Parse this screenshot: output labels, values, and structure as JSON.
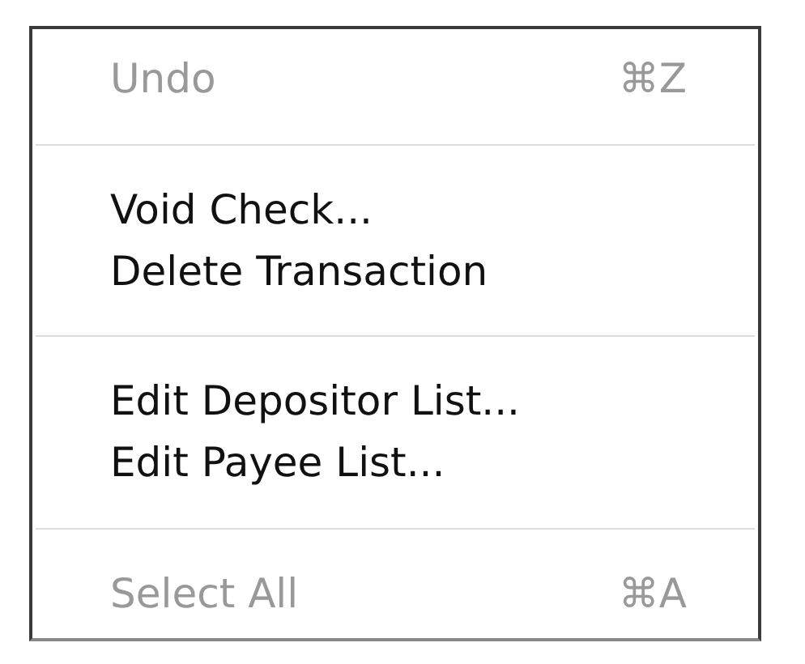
{
  "menu": {
    "sections": [
      {
        "items": [
          {
            "label": "Undo",
            "shortcut": "⌘Z",
            "disabled": true
          }
        ]
      },
      {
        "items": [
          {
            "label": "Void Check...",
            "disabled": false
          },
          {
            "label": "Delete Transaction",
            "disabled": false
          }
        ]
      },
      {
        "items": [
          {
            "label": "Edit Depositor List...",
            "disabled": false
          },
          {
            "label": "Edit Payee List...",
            "disabled": false
          }
        ]
      },
      {
        "items": [
          {
            "label": "Select All",
            "shortcut": "⌘A",
            "disabled": true
          }
        ]
      }
    ]
  }
}
